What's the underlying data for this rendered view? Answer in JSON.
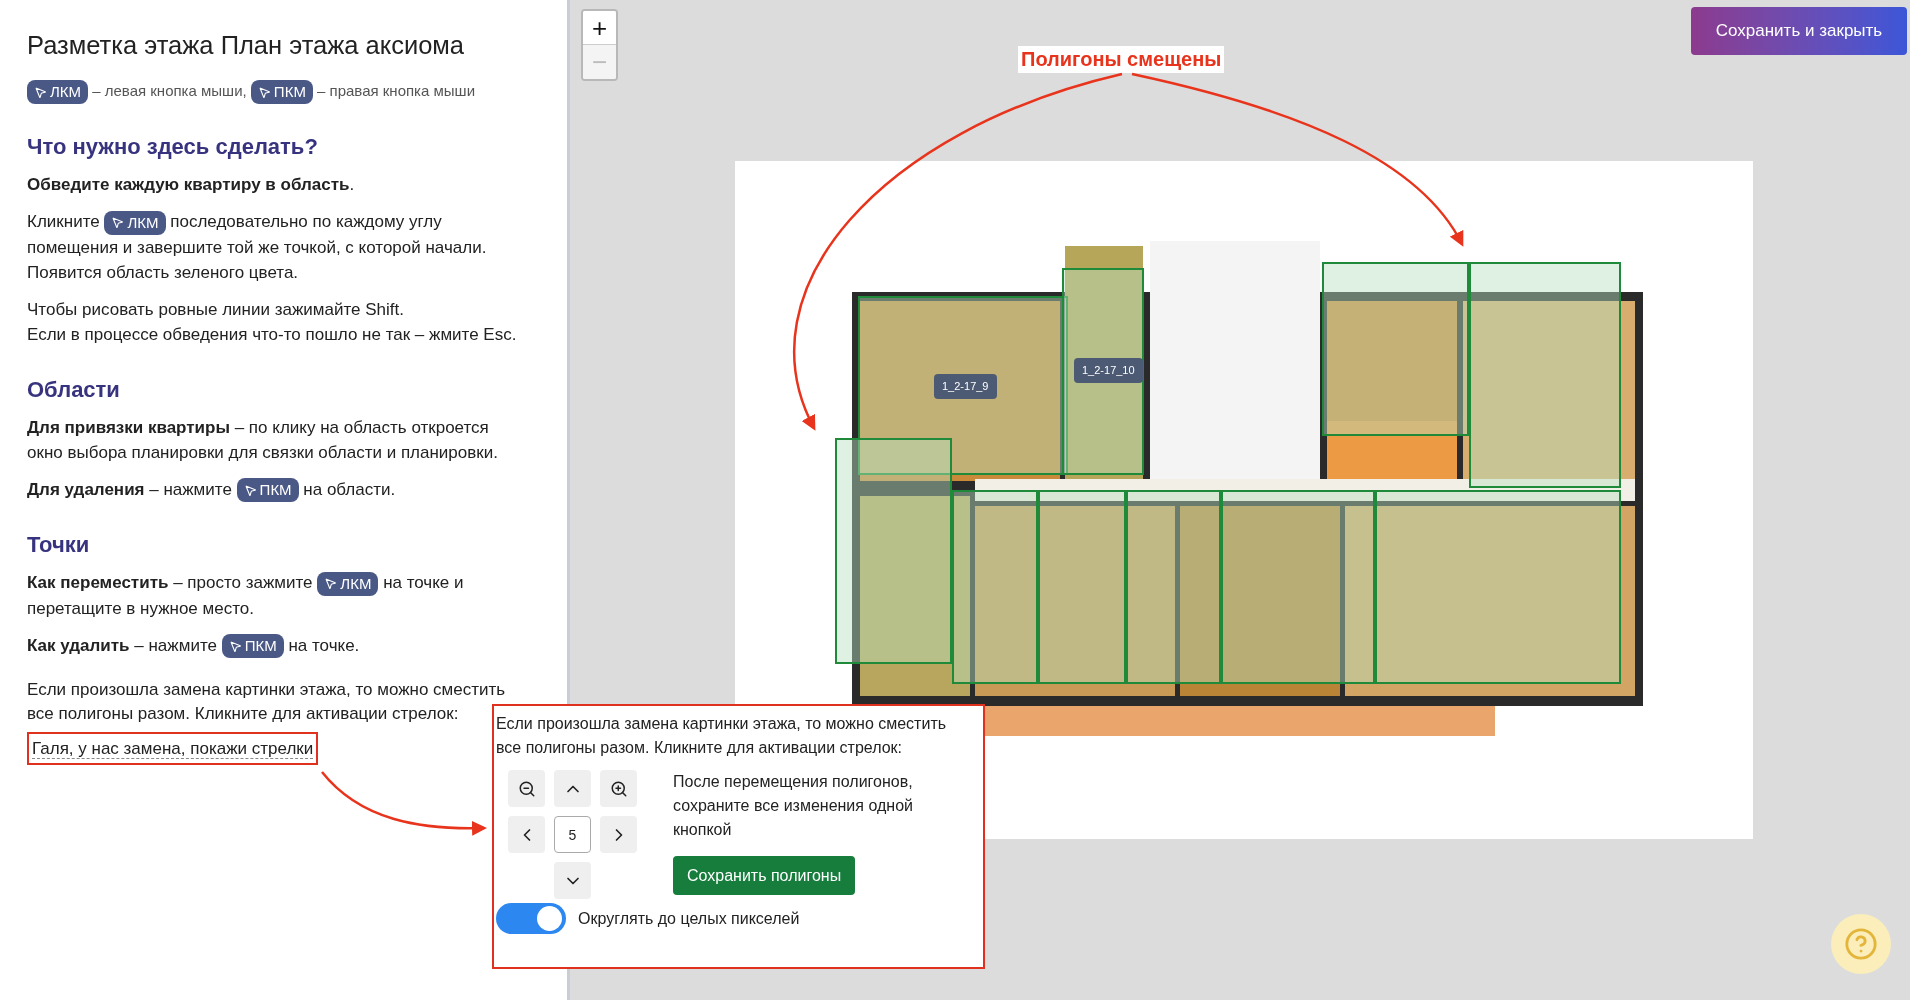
{
  "sidebar": {
    "title": "Разметка этажа План этажа аксиома",
    "legend": [
      {
        "kind": "key",
        "text": "ЛКМ"
      },
      {
        "kind": "text",
        "text": "– левая кнопка мыши,"
      },
      {
        "kind": "key",
        "text": "ПКМ"
      },
      {
        "kind": "text",
        "text": "– правая кнопка мыши"
      }
    ],
    "sections": [
      {
        "heading": "Что нужно здесь сделать?",
        "paragraphs": [
          [
            {
              "kind": "text",
              "text": "**Обведите каждую квартиру в область**."
            }
          ],
          [
            {
              "kind": "text",
              "text": "Кликните"
            },
            {
              "kind": "key",
              "text": "ЛКМ"
            },
            {
              "kind": "text",
              "text": "последовательно по каждому углу"
            },
            {
              "kind": "break"
            },
            {
              "kind": "text",
              "text": "помещения и завершите той же точкой, с которой начали."
            },
            {
              "kind": "break"
            },
            {
              "kind": "text",
              "text": "Появится область зеленого цвета."
            }
          ],
          [
            {
              "kind": "text",
              "text": "Чтобы рисовать ровные линии зажимайте Shift."
            },
            {
              "kind": "break"
            },
            {
              "kind": "text",
              "text": "Если в процессе обведения что-то пошло не так – жмите Esc."
            }
          ]
        ]
      },
      {
        "heading": "Области",
        "paragraphs": [
          [
            {
              "kind": "text",
              "text": "**Для привязки квартиры** – по клику на область откроется"
            },
            {
              "kind": "break"
            },
            {
              "kind": "text",
              "text": "окно выбора планировки для связки области и планировки."
            }
          ],
          [
            {
              "kind": "text",
              "text": "**Для удаления** – нажмите"
            },
            {
              "kind": "key",
              "text": "ПКМ"
            },
            {
              "kind": "text",
              "text": "на области."
            }
          ]
        ]
      },
      {
        "heading": "Точки",
        "paragraphs": [
          [
            {
              "kind": "text",
              "text": "**Как переместить** – просто зажмите"
            },
            {
              "kind": "key",
              "text": "ЛКМ"
            },
            {
              "kind": "text",
              "text": "на точке и"
            },
            {
              "kind": "break"
            },
            {
              "kind": "text",
              "text": "перетащите в нужное место."
            }
          ],
          [
            {
              "kind": "text",
              "text": "**Как удалить** – нажмите"
            },
            {
              "kind": "key",
              "text": "ПКМ"
            },
            {
              "kind": "text",
              "text": "на точке."
            }
          ]
        ]
      }
    ],
    "shift_hint": [
      "Если произошла замена картинки этажа, то можно сместить",
      "все полигоны разом. Кликните для активации стрелок:"
    ],
    "shift_link": "Галя, у нас замена, покажи стрелки"
  },
  "map": {
    "zoom_in": {
      "label": "+",
      "disabled": false
    },
    "zoom_out": {
      "label": "−",
      "disabled": true
    },
    "save_button": "Сохранить и закрыть",
    "polygon_labels": [
      "1_2-17_9",
      "1_2-17_10"
    ]
  },
  "shift_panel": {
    "description": "Если произошла замена картинки этажа, то можно сместить все полигоны разом. Кликните для активации стрелок:",
    "step": "5",
    "note": "После перемещения полигонов, сохраните все изменения одной кнопкой",
    "save_button": "Сохранить полигоны",
    "rounding": {
      "label": "Округлять до целых пикселей",
      "on": true
    }
  },
  "annotations": {
    "callout": "Полигоны смещены"
  }
}
